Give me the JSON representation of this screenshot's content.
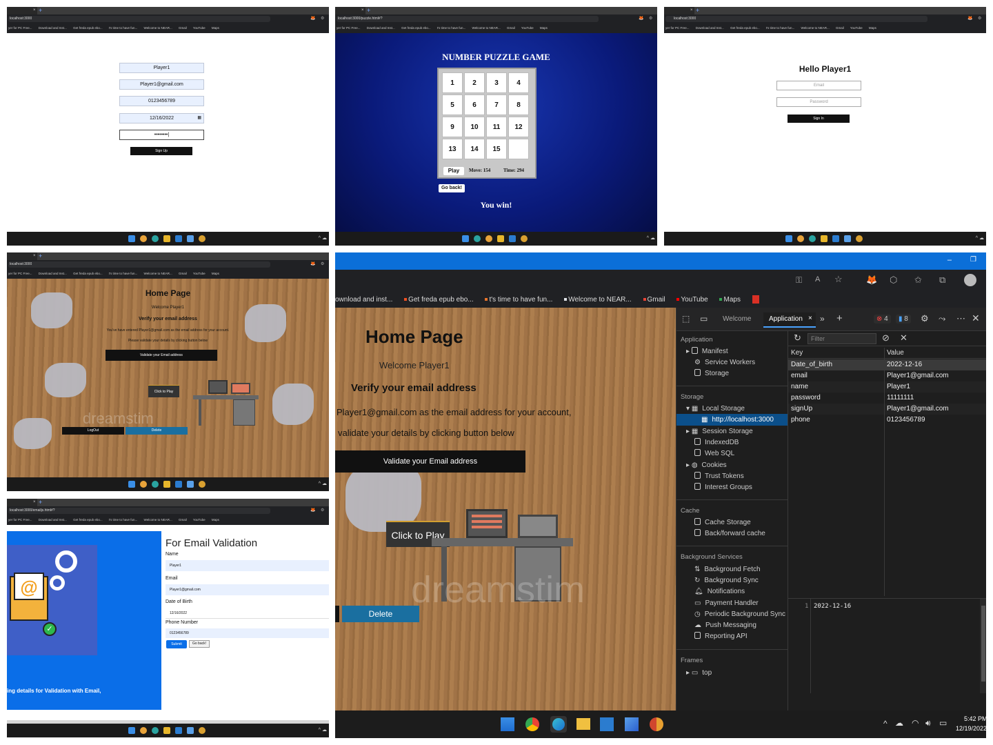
{
  "browser": {
    "tab_plus": "+",
    "tab_close": "×",
    "urls": {
      "signup": "localhost:3000",
      "puzzle": "localhost:3000/puzzle.html#?",
      "signin": "localhost:3000",
      "home": "localhost:3000",
      "email": "localhost:3000/emailjs.html#?"
    },
    "bookmarks_small": [
      "yer for PC Free...",
      "Download and Inst...",
      "Get freda epub ebo...",
      "t's time to have fun...",
      "Welcome to NEAR...",
      "Gmail",
      "YouTube",
      "Maps"
    ],
    "bookmarks_large": [
      "ownload and inst...",
      "Get freda epub ebo...",
      "t's time to have fun...",
      "Welcome to NEAR...",
      "Gmail",
      "YouTube",
      "Maps"
    ]
  },
  "signup": {
    "name": "Player1",
    "email": "Player1@gmail.com",
    "phone": "0123456789",
    "dob": "12/16/2022",
    "password": "••••••••|",
    "button": "Sign Up"
  },
  "puzzle": {
    "title": "NUMBER PUZZLE GAME",
    "tiles": [
      "1",
      "2",
      "3",
      "4",
      "5",
      "6",
      "7",
      "8",
      "9",
      "10",
      "11",
      "12",
      "13",
      "14",
      "15",
      ""
    ],
    "play": "Play",
    "moves": "Move: 154",
    "time": "Time: 294",
    "go_back": "Go back!",
    "win": "You win!"
  },
  "signin": {
    "hello": "Hello Player1",
    "email_ph": "Email",
    "password_ph": "Password",
    "button": "Sign In"
  },
  "home_small": {
    "title": "Home Page",
    "welcome": "Welcome Player1",
    "verify": "Verify your email address",
    "line1": "You've have entered Player1@gmail.com as the email address for your account.",
    "line2": "Please validate your details by clicking button below",
    "validate": "Validate your Email address",
    "play": "Click to Play",
    "logout": "LogOut",
    "delete": "Delete"
  },
  "email_form": {
    "title": "For Email Validation",
    "name_label": "Name",
    "name": "Player1",
    "email_label": "Email",
    "email": "Player1@gmail.com",
    "dob_label": "Date of Birth",
    "dob": "12/16/2022",
    "phone_label": "Phone Number",
    "phone": "0123456789",
    "submit": "Submit",
    "go_back": "Go back!",
    "caption": "ing details for Validation with Email,"
  },
  "home_large": {
    "title": "Home Page",
    "welcome": "Welcome Player1",
    "verify": "Verify your email address",
    "line1": "Player1@gmail.com as the email address for your account,",
    "line2": "validate your details by clicking button below",
    "validate": "Validate your Email address",
    "play": "Click to Play",
    "delete": "Delete",
    "watermark": "dreamstim"
  },
  "devtools": {
    "tab_welcome": "Welcome",
    "tab_application": "Application",
    "errors": "4",
    "messages": "8",
    "section_application": "Application",
    "app_items": [
      "Manifest",
      "Service Workers",
      "Storage"
    ],
    "section_storage": "Storage",
    "storage_items": [
      "Local Storage",
      "http://localhost:3000",
      "Session Storage",
      "IndexedDB",
      "Web SQL",
      "Cookies",
      "Trust Tokens",
      "Interest Groups"
    ],
    "section_cache": "Cache",
    "cache_items": [
      "Cache Storage",
      "Back/forward cache"
    ],
    "section_bg": "Background Services",
    "bg_items": [
      "Background Fetch",
      "Background Sync",
      "Notifications",
      "Payment Handler",
      "Periodic Background Sync",
      "Push Messaging",
      "Reporting API"
    ],
    "section_frames": "Frames",
    "frames_items": [
      "top"
    ],
    "filter_ph": "Filter",
    "col_key": "Key",
    "col_value": "Value",
    "rows": [
      {
        "k": "Date_of_birth",
        "v": "2022-12-16"
      },
      {
        "k": "email",
        "v": "Player1@gmail.com"
      },
      {
        "k": "name",
        "v": "Player1"
      },
      {
        "k": "password",
        "v": "11111111"
      },
      {
        "k": "signUp",
        "v": "Player1@gmail.com"
      },
      {
        "k": "phone",
        "v": "0123456789"
      }
    ],
    "preview_line": "1",
    "preview_value": "2022-12-16"
  },
  "taskbar": {
    "time": "5:42 PM",
    "date": "12/19/2022"
  },
  "colors": {
    "puzzle_bg": "#0a1a7a",
    "email_blue": "#0a6ee8",
    "devtools_bg": "#1e1e1e",
    "delete_btn": "#1a6fa0"
  }
}
